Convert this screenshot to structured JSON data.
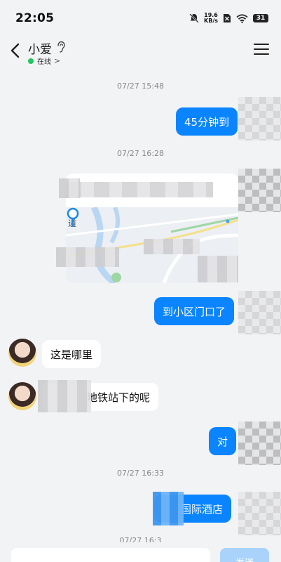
{
  "status_bar": {
    "time": "22:05",
    "net_speed_value": "19.6",
    "net_speed_unit": "KB/s",
    "battery": "31"
  },
  "header": {
    "contact_name": "小爱",
    "online_status": "在线",
    "online_chevron": ">"
  },
  "messages": {
    "ts1": "07/27 15:48",
    "msg1": "45分钟到",
    "ts2": "07/27 16:28",
    "map_road_label": "道",
    "msg3": "到小区门口了",
    "msg4": "这是哪里",
    "msg5": "地铁站下的呢",
    "msg6": "对",
    "ts3": "07/27 16:33",
    "msg7": "国际酒店",
    "ts4": "07/27 16:3"
  },
  "input": {
    "placeholder": "",
    "send_label": "发送"
  },
  "colors": {
    "bubble_out": "#0a84ff",
    "online_dot": "#22c55e",
    "send_disabled": "#a9d3fb"
  }
}
